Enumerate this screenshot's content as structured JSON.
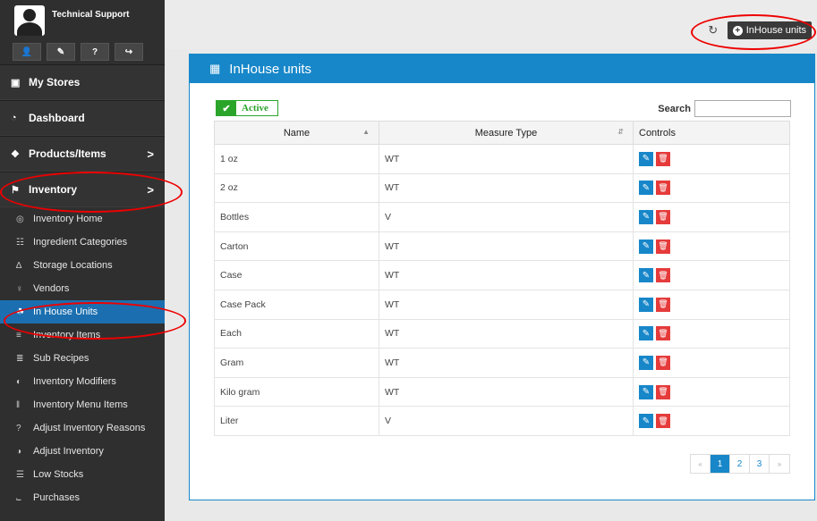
{
  "profile": {
    "name": "Technical Support",
    "tools": [
      "user-icon",
      "brush-icon",
      "help-icon",
      "logout-icon"
    ]
  },
  "sidebar": {
    "main_items": [
      {
        "label": "My Stores",
        "icon": "store-icon"
      },
      {
        "label": "Dashboard",
        "icon": "dashboard-icon"
      },
      {
        "label": "Products/Items",
        "icon": "gift-icon",
        "chevron": ">"
      },
      {
        "label": "Inventory",
        "icon": "inventory-icon",
        "chevron": ">"
      }
    ],
    "sub_items": [
      {
        "label": "Inventory Home",
        "icon": "home-icon"
      },
      {
        "label": "Ingredient Categories",
        "icon": "categories-icon"
      },
      {
        "label": "Storage Locations",
        "icon": "storage-icon"
      },
      {
        "label": "Vendors",
        "icon": "vendors-icon"
      },
      {
        "label": "In House Units",
        "icon": "units-icon",
        "active": true
      },
      {
        "label": "Inventory Items",
        "icon": "items-icon"
      },
      {
        "label": "Sub Recipes",
        "icon": "recipes-icon"
      },
      {
        "label": "Inventory Modifiers",
        "icon": "modifiers-icon"
      },
      {
        "label": "Inventory Menu Items",
        "icon": "menu-items-icon"
      },
      {
        "label": "Adjust Inventory Reasons",
        "icon": "question-icon"
      },
      {
        "label": "Adjust Inventory",
        "icon": "adjust-icon"
      },
      {
        "label": "Low Stocks",
        "icon": "stocks-icon"
      },
      {
        "label": "Purchases",
        "icon": "cart-icon"
      }
    ]
  },
  "topbar": {
    "add_label": "InHouse units"
  },
  "panel": {
    "title": "InHouse units",
    "active_label": "Active",
    "search_label": "Search",
    "search_value": "",
    "columns": [
      "Name",
      "Measure Type",
      "Controls"
    ],
    "rows": [
      {
        "name": "1 oz",
        "type": "WT"
      },
      {
        "name": "2 oz",
        "type": "WT"
      },
      {
        "name": "Bottles",
        "type": "V"
      },
      {
        "name": "Carton",
        "type": "WT"
      },
      {
        "name": "Case",
        "type": "WT"
      },
      {
        "name": "Case Pack",
        "type": "WT"
      },
      {
        "name": "Each",
        "type": "WT"
      },
      {
        "name": "Gram",
        "type": "WT"
      },
      {
        "name": "Kilo gram",
        "type": "WT"
      },
      {
        "name": "Liter",
        "type": "V"
      }
    ],
    "pagination": {
      "prev": "«",
      "pages": [
        "1",
        "2",
        "3"
      ],
      "current": "1",
      "next": "»"
    }
  },
  "colors": {
    "accent": "#1787c9",
    "sidebar": "#2f2f2f",
    "active_green": "#2aa52a",
    "delete_red": "#e63b3b",
    "annotation_red": "#ee0000"
  }
}
